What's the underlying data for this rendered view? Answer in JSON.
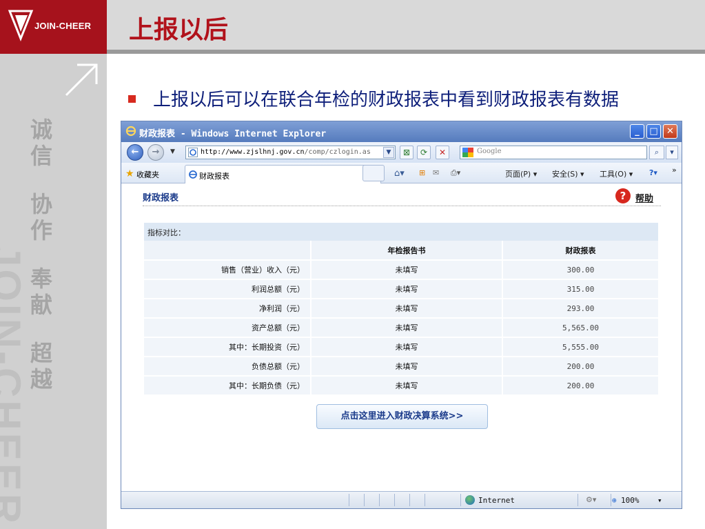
{
  "slide": {
    "brand": "JOIN-CHEER",
    "title": "上报以后",
    "motto": [
      "诚",
      "信",
      "协",
      "作",
      "奉",
      "献",
      "超",
      "越"
    ],
    "watermark": "JOIN-CHEER",
    "bullet": "上报以后可以在联合年检的财政报表中看到财政报表有数据"
  },
  "browser": {
    "window_title": "财政报表 - Windows Internet Explorer",
    "address_host": "http://www.zjslhnj.gov.cn",
    "address_path": "/comp/czlogin.as",
    "search_placeholder": "Google",
    "favorites_label": "收藏夹",
    "tab_label": "财政报表",
    "commands": {
      "page": "页面(P) ▾",
      "safety": "安全(S) ▾",
      "tools": "工具(O) ▾"
    },
    "status": {
      "zone": "Internet",
      "zoom": "100%"
    }
  },
  "page": {
    "header": "财政报表",
    "help_label": "帮助",
    "caption": "指标对比：",
    "columns": [
      "",
      "年检报告书",
      "财政报表"
    ],
    "rows": [
      {
        "label": "销售（营业）收入（元）",
        "annual": "未填写",
        "fin": "300.00"
      },
      {
        "label": "利润总额（元）",
        "annual": "未填写",
        "fin": "315.00"
      },
      {
        "label": "净利润（元）",
        "annual": "未填写",
        "fin": "293.00"
      },
      {
        "label": "资产总额（元）",
        "annual": "未填写",
        "fin": "5,565.00"
      },
      {
        "label": "其中：长期投资（元）",
        "annual": "未填写",
        "fin": "5,555.00"
      },
      {
        "label": "负债总额（元）",
        "annual": "未填写",
        "fin": "200.00"
      },
      {
        "label": "其中：长期负债（元）",
        "annual": "未填写",
        "fin": "200.00"
      }
    ],
    "enter_button": "点击这里进入财政决算系统>>"
  },
  "colors": {
    "brand_red": "#a6121c",
    "title_red": "#b1121b",
    "bullet_blue": "#0e1f7a",
    "ie_blue": "#557bbd"
  }
}
